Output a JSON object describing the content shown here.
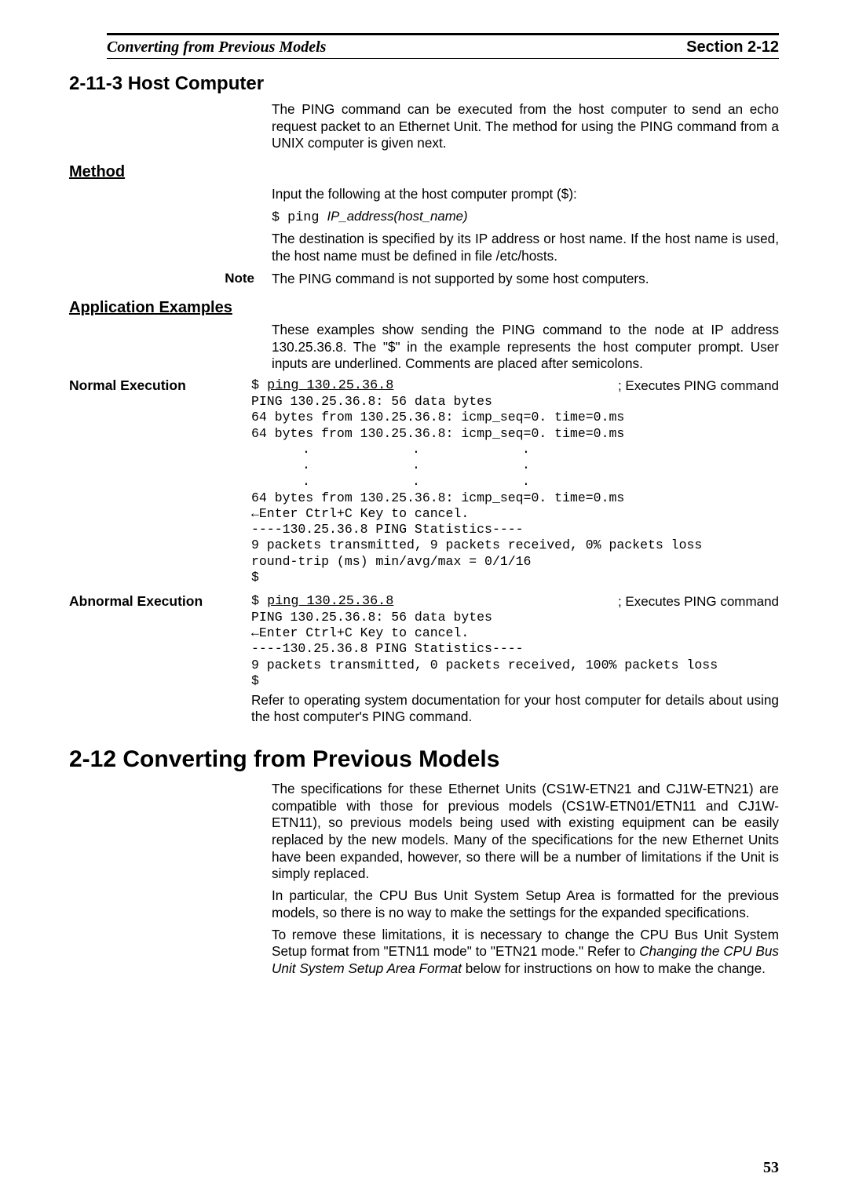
{
  "header": {
    "left": "Converting from Previous Models",
    "right": "Section 2-12"
  },
  "sec_hostcomp": {
    "heading": "2-11-3  Host Computer",
    "intro": "The PING command can be executed from the host computer to send an echo request packet to an Ethernet Unit. The method for using the PING command from a UNIX computer is given next."
  },
  "method": {
    "heading": "Method",
    "line1": "Input the following at the host computer prompt ($):",
    "cmd_prefix": "$ ping ",
    "cmd_arg": "IP_address(host_name)",
    "line2": "The destination is specified by its IP address or host name. If the host name is used, the host name must be defined in file /etc/hosts."
  },
  "note": {
    "label": "Note",
    "text": "The PING command is not supported by some host computers."
  },
  "appex": {
    "heading": "Application Examples",
    "intro": "These examples show sending the PING command to the node at IP address 130.25.36.8. The \"$\" in the example represents the host computer prompt. User inputs are underlined. Comments are placed after semicolons."
  },
  "normal": {
    "label": "Normal Execution",
    "cmd_dollar": "$ ",
    "cmd_underlined": "ping 130.25.36.8",
    "comment": "; Executes PING command",
    "block1": "PING 130.25.36.8: 56 data bytes\n64 bytes from 130.25.36.8: icmp_seq=0. time=0.ms\n64 bytes from 130.25.36.8: icmp_seq=0. time=0.ms",
    "block2": "64 bytes from 130.25.36.8: icmp_seq=0. time=0.ms\n←Enter Ctrl+C Key to cancel.\n----130.25.36.8 PING Statistics----\n9 packets transmitted, 9 packets received, 0% packets loss\nround-trip (ms) min/avg/max = 0/1/16\n$"
  },
  "abnormal": {
    "label": "Abnormal Execution",
    "cmd_dollar": "$ ",
    "cmd_underlined": "ping 130.25.36.8",
    "comment": "; Executes PING command",
    "block": "PING 130.25.36.8: 56 data bytes\n←Enter Ctrl+C Key to cancel.\n----130.25.36.8 PING Statistics----\n9 packets transmitted, 0 packets received, 100% packets loss\n$",
    "after": "Refer to operating system documentation for your host computer for details about using the host computer's PING command."
  },
  "convert": {
    "heading": "2-12  Converting from Previous Models",
    "p1": "The specifications for these Ethernet Units (CS1W-ETN21 and CJ1W-ETN21) are compatible with those for previous models (CS1W-ETN01/ETN11 and CJ1W-ETN11), so previous models being used with existing equipment can be easily replaced by the new models. Many of the specifications for the new Ethernet Units have been expanded, however, so there will be a number of limitations if the Unit is simply replaced.",
    "p2": "In particular, the CPU Bus Unit System Setup Area is formatted for the previous models, so there is no way to make the settings for the expanded specifications.",
    "p3_a": "To remove these limitations, it is necessary to change the CPU Bus Unit System Setup format from \"ETN11 mode\" to \"ETN21 mode.\" Refer to ",
    "p3_i": "Changing the CPU Bus Unit System Setup Area Format",
    "p3_b": " below for instructions on how to make the change."
  },
  "page_number": "53"
}
